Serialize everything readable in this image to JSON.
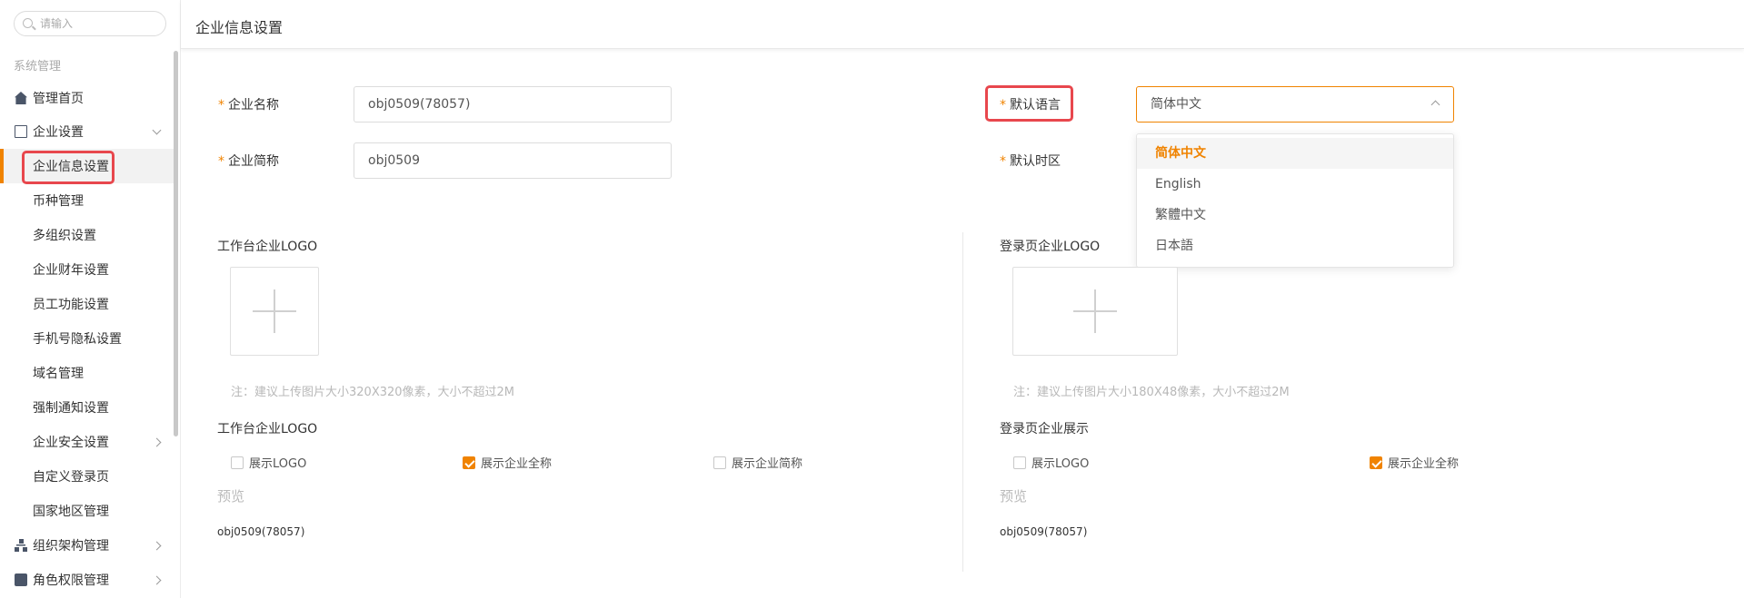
{
  "sidebar": {
    "search_placeholder": "请输入",
    "section_label": "系统管理",
    "items": [
      {
        "label": "管理首页"
      },
      {
        "label": "企业设置"
      },
      {
        "label": "企业信息设置"
      },
      {
        "label": "币种管理"
      },
      {
        "label": "多组织设置"
      },
      {
        "label": "企业财年设置"
      },
      {
        "label": "员工功能设置"
      },
      {
        "label": "手机号隐私设置"
      },
      {
        "label": "域名管理"
      },
      {
        "label": "强制通知设置"
      },
      {
        "label": "企业安全设置"
      },
      {
        "label": "自定义登录页"
      },
      {
        "label": "国家地区管理"
      },
      {
        "label": "组织架构管理"
      },
      {
        "label": "角色权限管理"
      }
    ]
  },
  "header": {
    "title": "企业信息设置"
  },
  "form": {
    "required_mark": "*",
    "company_name_label": "企业名称",
    "company_name_value": "obj0509(78057)",
    "company_short_label": "企业简称",
    "company_short_value": "obj0509",
    "default_lang_label": "默认语言",
    "default_lang_value": "简体中文",
    "default_tz_label": "默认时区",
    "lang_options": [
      "简体中文",
      "English",
      "繁體中文",
      "日本語"
    ]
  },
  "workbench": {
    "logo_title": "工作台企业LOGO",
    "note": "注：建议上传图片大小320X320像素，大小不超过2M",
    "display_title": "工作台企业LOGO",
    "options": [
      {
        "label": "展示LOGO",
        "checked": false
      },
      {
        "label": "展示企业全称",
        "checked": true
      },
      {
        "label": "展示企业简称",
        "checked": false
      }
    ],
    "preview_label": "预览",
    "preview_value": "obj0509(78057)"
  },
  "login": {
    "logo_title": "登录页企业LOGO",
    "note": "注：建议上传图片大小180X48像素，大小不超过2M",
    "display_title": "登录页企业展示",
    "options": [
      {
        "label": "展示LOGO",
        "checked": false
      },
      {
        "label": "展示企业全称",
        "checked": true
      }
    ],
    "preview_label": "预览",
    "preview_value": "obj0509(78057)"
  },
  "colors": {
    "accent": "#f08300",
    "highlight": "#e8474d"
  }
}
